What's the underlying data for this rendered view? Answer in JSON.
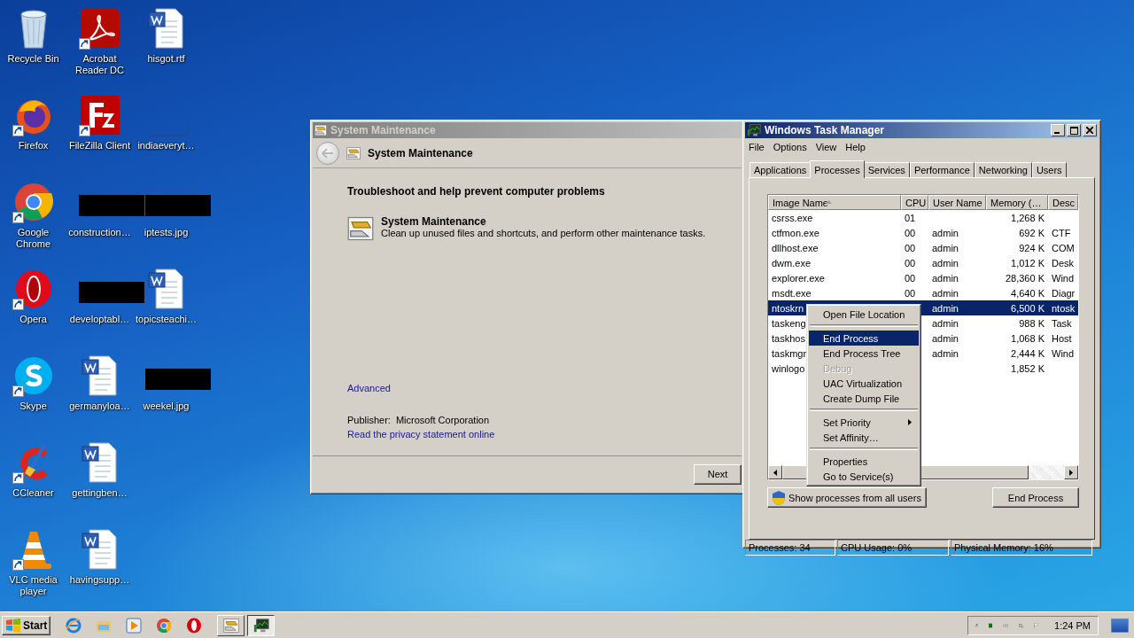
{
  "desktop": {
    "icon_columns": [
      [
        {
          "label": "Recycle Bin",
          "kind": "recycle",
          "shortcut": false
        },
        {
          "label": "Firefox",
          "kind": "firefox",
          "shortcut": true
        },
        {
          "label": "Google Chrome",
          "kind": "chrome",
          "shortcut": true
        },
        {
          "label": "Opera",
          "kind": "opera",
          "shortcut": true
        },
        {
          "label": "Skype",
          "kind": "skype",
          "shortcut": true
        },
        {
          "label": "CCleaner",
          "kind": "ccleaner",
          "shortcut": true
        },
        {
          "label": "VLC media player",
          "kind": "vlc",
          "shortcut": true
        }
      ],
      [
        {
          "label": "Acrobat Reader DC",
          "kind": "acrobat",
          "shortcut": true
        },
        {
          "label": "FileZilla Client",
          "kind": "filezilla",
          "shortcut": true
        },
        {
          "label": "construction…",
          "kind": "thumbnail",
          "shortcut": false
        },
        {
          "label": "developtabl…",
          "kind": "thumbnail",
          "shortcut": false
        },
        {
          "label": "germanyloa…",
          "kind": "word",
          "shortcut": false
        },
        {
          "label": "gettingben…",
          "kind": "word",
          "shortcut": false
        },
        {
          "label": "havingsupp…",
          "kind": "word",
          "shortcut": false
        }
      ],
      [
        {
          "label": "hisgot.rtf",
          "kind": "word",
          "shortcut": false
        },
        {
          "label": "indiaeveryt…",
          "kind": "blank",
          "shortcut": false
        },
        {
          "label": "iptests.jpg",
          "kind": "thumbnail",
          "shortcut": false
        },
        {
          "label": "topicsteachi…",
          "kind": "word",
          "shortcut": false
        },
        {
          "label": "weekel.jpg",
          "kind": "thumbnail",
          "shortcut": false
        }
      ]
    ]
  },
  "maintenance_window": {
    "title": "System Maintenance",
    "active": false,
    "nav_title": "System Maintenance",
    "heading": "Troubleshoot and help prevent computer problems",
    "task_title": "System Maintenance",
    "task_description": "Clean up unused files and shortcuts, and perform other maintenance tasks.",
    "advanced_link": "Advanced",
    "publisher_label": "Publisher:",
    "publisher": "Microsoft Corporation",
    "privacy_link": "Read the privacy statement online",
    "next_button": "Next"
  },
  "task_manager": {
    "title": "Windows Task Manager",
    "active": true,
    "menu": [
      "File",
      "Options",
      "View",
      "Help"
    ],
    "tabs": [
      {
        "label": "Applications",
        "selected": false
      },
      {
        "label": "Processes",
        "selected": true
      },
      {
        "label": "Services",
        "selected": false
      },
      {
        "label": "Performance",
        "selected": false
      },
      {
        "label": "Networking",
        "selected": false
      },
      {
        "label": "Users",
        "selected": false
      }
    ],
    "columns": [
      {
        "label": "Image Name",
        "sorted": true
      },
      {
        "label": "CPU",
        "sorted": false
      },
      {
        "label": "User Name",
        "sorted": false
      },
      {
        "label": "Memory (…",
        "sorted": false
      },
      {
        "label": "Desc",
        "sorted": false
      }
    ],
    "rows": [
      {
        "image_name": "csrss.exe",
        "cpu": "01",
        "user_name": "",
        "memory": "1,268 K",
        "description": "",
        "selected": false
      },
      {
        "image_name": "ctfmon.exe",
        "cpu": "00",
        "user_name": "admin",
        "memory": "692 K",
        "description": "CTF",
        "selected": false
      },
      {
        "image_name": "dllhost.exe",
        "cpu": "00",
        "user_name": "admin",
        "memory": "924 K",
        "description": "COM",
        "selected": false
      },
      {
        "image_name": "dwm.exe",
        "cpu": "00",
        "user_name": "admin",
        "memory": "1,012 K",
        "description": "Desk",
        "selected": false
      },
      {
        "image_name": "explorer.exe",
        "cpu": "00",
        "user_name": "admin",
        "memory": "28,360 K",
        "description": "Wind",
        "selected": false
      },
      {
        "image_name": "msdt.exe",
        "cpu": "00",
        "user_name": "admin",
        "memory": "4,640 K",
        "description": "Diagr",
        "selected": false
      },
      {
        "image_name": "ntoskrn",
        "cpu": "",
        "user_name": "admin",
        "memory": "6,500 K",
        "description": "ntosk",
        "selected": true
      },
      {
        "image_name": "taskeng",
        "cpu": "",
        "user_name": "admin",
        "memory": "988 K",
        "description": "Task",
        "selected": false
      },
      {
        "image_name": "taskhos",
        "cpu": "",
        "user_name": "admin",
        "memory": "1,068 K",
        "description": "Host",
        "selected": false
      },
      {
        "image_name": "taskmgr",
        "cpu": "",
        "user_name": "admin",
        "memory": "2,444 K",
        "description": "Wind",
        "selected": false
      },
      {
        "image_name": "winlogo",
        "cpu": "",
        "user_name": "",
        "memory": "1,852 K",
        "description": "",
        "selected": false
      }
    ],
    "context_menu": [
      {
        "kind": "item",
        "label": "Open File Location",
        "selected": false,
        "disabled": false,
        "submenu": false
      },
      {
        "kind": "separator"
      },
      {
        "kind": "item",
        "label": "End Process",
        "selected": true,
        "disabled": false,
        "submenu": false
      },
      {
        "kind": "item",
        "label": "End Process Tree",
        "selected": false,
        "disabled": false,
        "submenu": false
      },
      {
        "kind": "item",
        "label": "Debug",
        "selected": false,
        "disabled": true,
        "submenu": false
      },
      {
        "kind": "item",
        "label": "UAC Virtualization",
        "selected": false,
        "disabled": false,
        "submenu": false
      },
      {
        "kind": "item",
        "label": "Create Dump File",
        "selected": false,
        "disabled": false,
        "submenu": false
      },
      {
        "kind": "separator"
      },
      {
        "kind": "item",
        "label": "Set Priority",
        "selected": false,
        "disabled": false,
        "submenu": true
      },
      {
        "kind": "item",
        "label": "Set Affinity…",
        "selected": false,
        "disabled": false,
        "submenu": false
      },
      {
        "kind": "separator"
      },
      {
        "kind": "item",
        "label": "Properties",
        "selected": false,
        "disabled": false,
        "submenu": false
      },
      {
        "kind": "item",
        "label": "Go to Service(s)",
        "selected": false,
        "disabled": false,
        "submenu": false
      }
    ],
    "show_all_button": "Show processes from all users",
    "end_button": "End Process",
    "status": [
      "Processes: 34",
      "CPU Usage: 0%",
      "Physical Memory: 16%"
    ]
  },
  "taskbar": {
    "start": "Start",
    "quick_launch": [
      {
        "kind": "ie"
      },
      {
        "kind": "explorer"
      },
      {
        "kind": "media"
      },
      {
        "kind": "chrome"
      },
      {
        "kind": "opera"
      }
    ],
    "tasks": [
      {
        "kind": "maintenance",
        "active": false
      },
      {
        "kind": "taskmgr",
        "active": true
      }
    ],
    "clock": "1:24 PM"
  }
}
